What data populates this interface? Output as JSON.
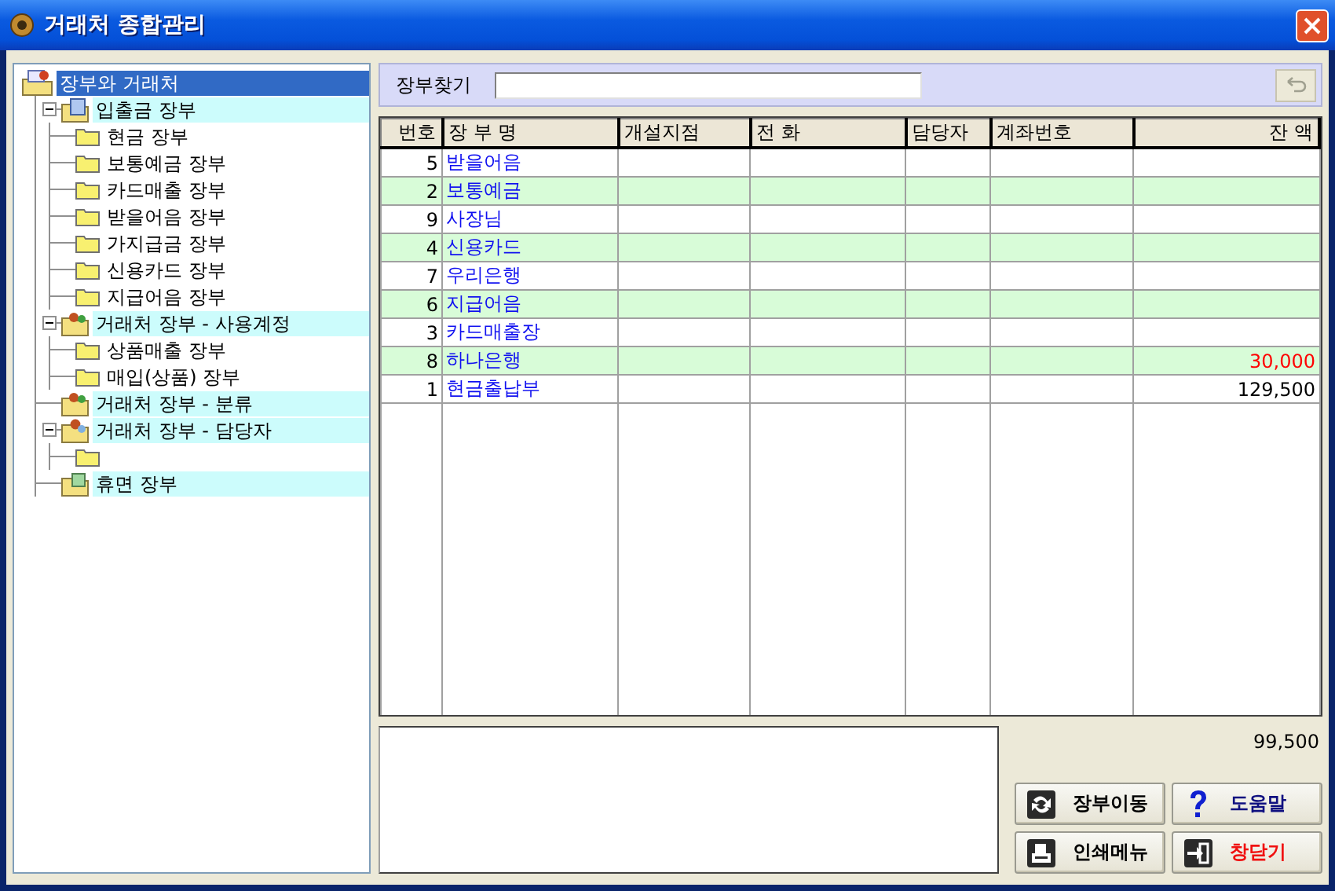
{
  "window": {
    "title": "거래처 종합관리"
  },
  "tree": {
    "label": "장부와 거래처",
    "kind": "root",
    "selected": true,
    "children": [
      {
        "label": "입출금 장부",
        "kind": "ledger",
        "expanded": true,
        "selected": false,
        "children": [
          {
            "label": "현금 장부",
            "kind": "folder",
            "selected": false
          },
          {
            "label": "보통예금 장부",
            "kind": "folder",
            "selected": false
          },
          {
            "label": "카드매출 장부",
            "kind": "folder",
            "selected": false
          },
          {
            "label": "받을어음 장부",
            "kind": "folder",
            "selected": false
          },
          {
            "label": "가지급금 장부",
            "kind": "folder",
            "selected": false
          },
          {
            "label": "신용카드 장부",
            "kind": "folder",
            "selected": false
          },
          {
            "label": "지급어음 장부",
            "kind": "folder",
            "selected": false
          }
        ]
      },
      {
        "label": "거래처 장부 - 사용계정",
        "kind": "people",
        "expanded": true,
        "selected": false,
        "children": [
          {
            "label": "상품매출 장부",
            "kind": "folder",
            "selected": false
          },
          {
            "label": "매입(상품) 장부",
            "kind": "folder",
            "selected": false
          }
        ]
      },
      {
        "label": "거래처 장부 - 분류",
        "kind": "people",
        "selected": false
      },
      {
        "label": "거래처 장부 - 담당자",
        "kind": "person",
        "expanded": true,
        "selected": false,
        "children": [
          {
            "kind": "folder",
            "selected": false
          }
        ]
      },
      {
        "label": "휴면 장부",
        "kind": "dormant",
        "selected": false
      }
    ]
  },
  "search": {
    "label": "장부찾기"
  },
  "table": {
    "columns": [
      "번호",
      "장 부 명",
      "개설지점",
      "전 화",
      "담당자",
      "계좌번호",
      "잔 액"
    ],
    "rows": [
      {
        "no": "5",
        "name": "받을어음"
      },
      {
        "no": "2",
        "name": "보통예금"
      },
      {
        "no": "9",
        "name": "사장님"
      },
      {
        "no": "4",
        "name": "신용카드"
      },
      {
        "no": "7",
        "name": "우리은행"
      },
      {
        "no": "6",
        "name": "지급어음"
      },
      {
        "no": "3",
        "name": "카드매출장"
      },
      {
        "no": "8",
        "name": "하나은행",
        "balance": "30,000",
        "color": "#ff0000"
      },
      {
        "no": "1",
        "name": "현금출납부",
        "balance": "129,500",
        "color": "#000000"
      }
    ]
  },
  "total": "99,500",
  "buttons": [
    {
      "label": "장부이동",
      "kind": "move"
    },
    {
      "label": "도움말",
      "kind": "help"
    },
    {
      "label": "인쇄메뉴",
      "kind": "print"
    },
    {
      "label": "창닫기",
      "kind": "close"
    }
  ]
}
